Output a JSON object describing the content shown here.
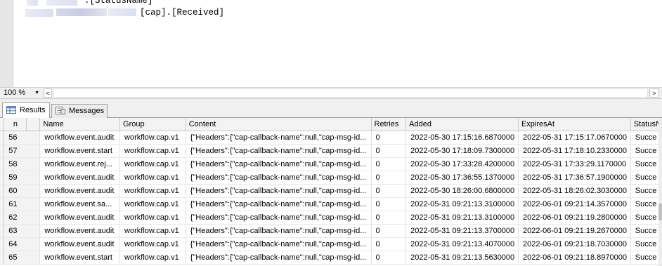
{
  "editor": {
    "lines": [
      ".[StatusName]",
      "[cap].[Received]"
    ]
  },
  "zoom": {
    "value": "100 %",
    "left_arrow": "<",
    "right_arrow": ">"
  },
  "tabs": [
    {
      "label": "Results",
      "icon": "grid-icon",
      "active": true
    },
    {
      "label": "Messages",
      "icon": "messages-icon",
      "active": false
    }
  ],
  "grid": {
    "columns": [
      "n",
      "Name",
      "Group",
      "Content",
      "Retries",
      "Added",
      "ExpiresAt",
      "StatusN"
    ],
    "rows": [
      [
        "56",
        "workflow.event.audit",
        "workflow.cap.v1",
        "{\"Headers\":{\"cap-callback-name\":null,\"cap-msg-id...",
        "0",
        "2022-05-30 17:15:16.6870000",
        "2022-05-31 17:15:17.0670000",
        "Succe"
      ],
      [
        "57",
        "workflow.event.start",
        "workflow.cap.v1",
        "{\"Headers\":{\"cap-callback-name\":null,\"cap-msg-id...",
        "0",
        "2022-05-30 17:18:09.7300000",
        "2022-05-31 17:18:10.2330000",
        "Succe"
      ],
      [
        "58",
        "workflow.event.rej...",
        "workflow.cap.v1",
        "{\"Headers\":{\"cap-callback-name\":null,\"cap-msg-id...",
        "0",
        "2022-05-30 17:33:28.4200000",
        "2022-05-31 17:33:29.1170000",
        "Succe"
      ],
      [
        "59",
        "workflow.event.audit",
        "workflow.cap.v1",
        "{\"Headers\":{\"cap-callback-name\":null,\"cap-msg-id...",
        "0",
        "2022-05-30 17:36:55.1370000",
        "2022-05-31 17:36:57.1900000",
        "Succe"
      ],
      [
        "60",
        "workflow.event.audit",
        "workflow.cap.v1",
        "{\"Headers\":{\"cap-callback-name\":null,\"cap-msg-id...",
        "0",
        "2022-05-30 18:26:00.6800000",
        "2022-05-31 18:26:02.3030000",
        "Succe"
      ],
      [
        "61",
        "workflow.event.sa...",
        "workflow.cap.v1",
        "{\"Headers\":{\"cap-callback-name\":null,\"cap-msg-id...",
        "0",
        "2022-05-31 09:21:13.3100000",
        "2022-06-01 09:21:14.3570000",
        "Succe"
      ],
      [
        "62",
        "workflow.event.audit",
        "workflow.cap.v1",
        "{\"Headers\":{\"cap-callback-name\":null,\"cap-msg-id...",
        "0",
        "2022-05-31 09:21:13.3100000",
        "2022-06-01 09:21:19.2800000",
        "Succe"
      ],
      [
        "63",
        "workflow.event.audit",
        "workflow.cap.v1",
        "{\"Headers\":{\"cap-callback-name\":null,\"cap-msg-id...",
        "0",
        "2022-05-31 09:21:13.3700000",
        "2022-06-01 09:21:19.2670000",
        "Succe"
      ],
      [
        "64",
        "workflow.event.audit",
        "workflow.cap.v1",
        "{\"Headers\":{\"cap-callback-name\":null,\"cap-msg-id...",
        "0",
        "2022-05-31 09:21:13.4070000",
        "2022-06-01 09:21:18.7030000",
        "Succe"
      ],
      [
        "65",
        "workflow.event.start",
        "workflow.cap.v1",
        "{\"Headers\":{\"cap-callback-name\":null,\"cap-msg-id...",
        "0",
        "2022-05-31 09:21:13.5630000",
        "2022-06-01 09:21:18.8970000",
        "Succe"
      ]
    ]
  }
}
